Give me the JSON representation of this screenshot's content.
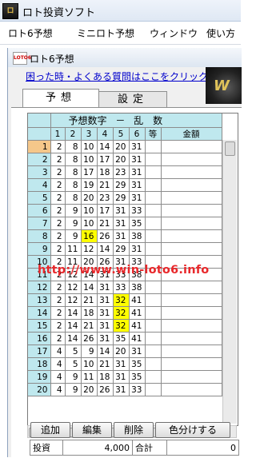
{
  "window": {
    "title": "ロト投資ソフト",
    "icon": "loto-app-icon"
  },
  "menu": [
    "ロト6予想",
    "ミニロト予想",
    "ウィンドウ",
    "使い方"
  ],
  "child_window": {
    "title": "ロト6予想",
    "icon": "loto6-icon"
  },
  "help_link": "困った時・よくある質問はここをクリック",
  "tabs": [
    {
      "label": "予想",
      "active": true
    },
    {
      "label": "設定",
      "active": false
    }
  ],
  "grid": {
    "title_left": "予想数字",
    "title_dash": "－",
    "title_right": "乱　数",
    "columns": [
      "1",
      "2",
      "3",
      "4",
      "5",
      "6",
      "等",
      "金額"
    ],
    "rows": [
      {
        "n": "1",
        "v": [
          "2",
          "8",
          "10",
          "14",
          "20",
          "31"
        ],
        "selected": true
      },
      {
        "n": "2",
        "v": [
          "2",
          "8",
          "10",
          "17",
          "20",
          "31"
        ]
      },
      {
        "n": "3",
        "v": [
          "2",
          "8",
          "17",
          "18",
          "23",
          "31"
        ]
      },
      {
        "n": "4",
        "v": [
          "2",
          "8",
          "19",
          "21",
          "29",
          "31"
        ]
      },
      {
        "n": "5",
        "v": [
          "2",
          "8",
          "20",
          "23",
          "29",
          "31"
        ]
      },
      {
        "n": "6",
        "v": [
          "2",
          "9",
          "10",
          "17",
          "31",
          "33"
        ]
      },
      {
        "n": "7",
        "v": [
          "2",
          "9",
          "10",
          "21",
          "31",
          "35"
        ]
      },
      {
        "n": "8",
        "v": [
          "2",
          "9",
          "16",
          "26",
          "31",
          "38"
        ],
        "hl": [
          2
        ]
      },
      {
        "n": "9",
        "v": [
          "2",
          "11",
          "12",
          "14",
          "29",
          "31"
        ]
      },
      {
        "n": "10",
        "v": [
          "2",
          "11",
          "20",
          "26",
          "31",
          "33"
        ]
      },
      {
        "n": "11",
        "v": [
          "2",
          "12",
          "14",
          "31",
          "33",
          "38"
        ]
      },
      {
        "n": "12",
        "v": [
          "2",
          "12",
          "14",
          "31",
          "33",
          "38"
        ]
      },
      {
        "n": "13",
        "v": [
          "2",
          "12",
          "21",
          "31",
          "32",
          "41"
        ],
        "hl": [
          4
        ]
      },
      {
        "n": "14",
        "v": [
          "2",
          "14",
          "18",
          "31",
          "32",
          "41"
        ],
        "hl": [
          4
        ]
      },
      {
        "n": "15",
        "v": [
          "2",
          "14",
          "21",
          "31",
          "32",
          "41"
        ],
        "hl": [
          4
        ]
      },
      {
        "n": "16",
        "v": [
          "2",
          "14",
          "26",
          "31",
          "35",
          "41"
        ]
      },
      {
        "n": "17",
        "v": [
          "4",
          "5",
          "9",
          "14",
          "20",
          "31"
        ]
      },
      {
        "n": "18",
        "v": [
          "4",
          "5",
          "10",
          "21",
          "31",
          "35"
        ]
      },
      {
        "n": "19",
        "v": [
          "4",
          "9",
          "11",
          "18",
          "31",
          "35"
        ]
      },
      {
        "n": "20",
        "v": [
          "4",
          "9",
          "20",
          "26",
          "31",
          "33"
        ]
      }
    ]
  },
  "watermark": "http://www.win-loto6.info",
  "buttons": [
    "追加",
    "編集",
    "削除",
    "色分けする"
  ],
  "stats": {
    "invest_label": "投資",
    "invest_value": "4,000",
    "total_label": "合計",
    "total_value": "0"
  },
  "colors": {
    "header_bg": "#bfe8ee",
    "selected_row": "#f5c78a",
    "highlight": "#ffff00",
    "link": "#0000cc",
    "watermark": "#e8282b"
  }
}
